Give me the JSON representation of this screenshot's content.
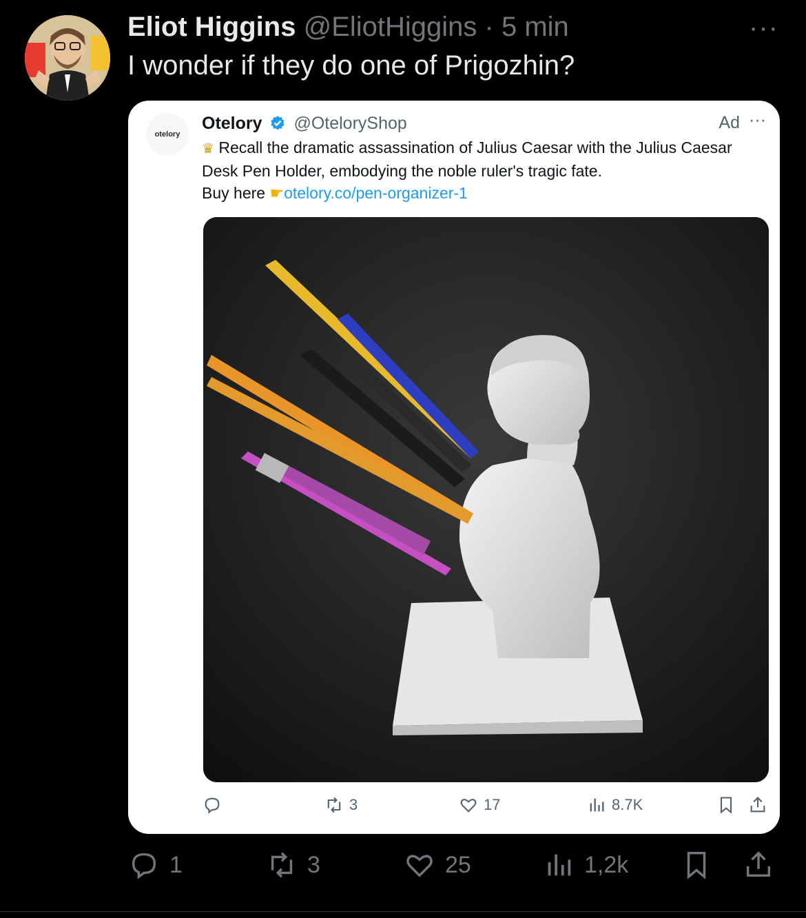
{
  "tweet": {
    "author_name": "Eliot Higgins",
    "author_handle": "@EliotHiggins",
    "separator": "·",
    "time": "5 min",
    "text": "I wonder if they do one of Prigozhin?",
    "more": "···"
  },
  "quoted_ad": {
    "logo_text": "otelory",
    "name": "Otelory",
    "handle": "@OteloryShop",
    "ad_label": "Ad",
    "more": "···",
    "text_main": "Recall the dramatic assassination of Julius Caesar with the Julius Caesar Desk Pen Holder, embodying the noble ruler's tragic fate.",
    "buy_here": "Buy here",
    "link": "otelory.co/pen-organizer-1",
    "actions": {
      "reply_count": "",
      "retweet_count": "3",
      "like_count": "17",
      "views_count": "8.7K"
    }
  },
  "actions": {
    "reply_count": "1",
    "retweet_count": "3",
    "like_count": "25",
    "views_count": "1,2k"
  },
  "colors": {
    "background": "#000000",
    "link": "#1d9bf0",
    "muted": "#71767b"
  }
}
